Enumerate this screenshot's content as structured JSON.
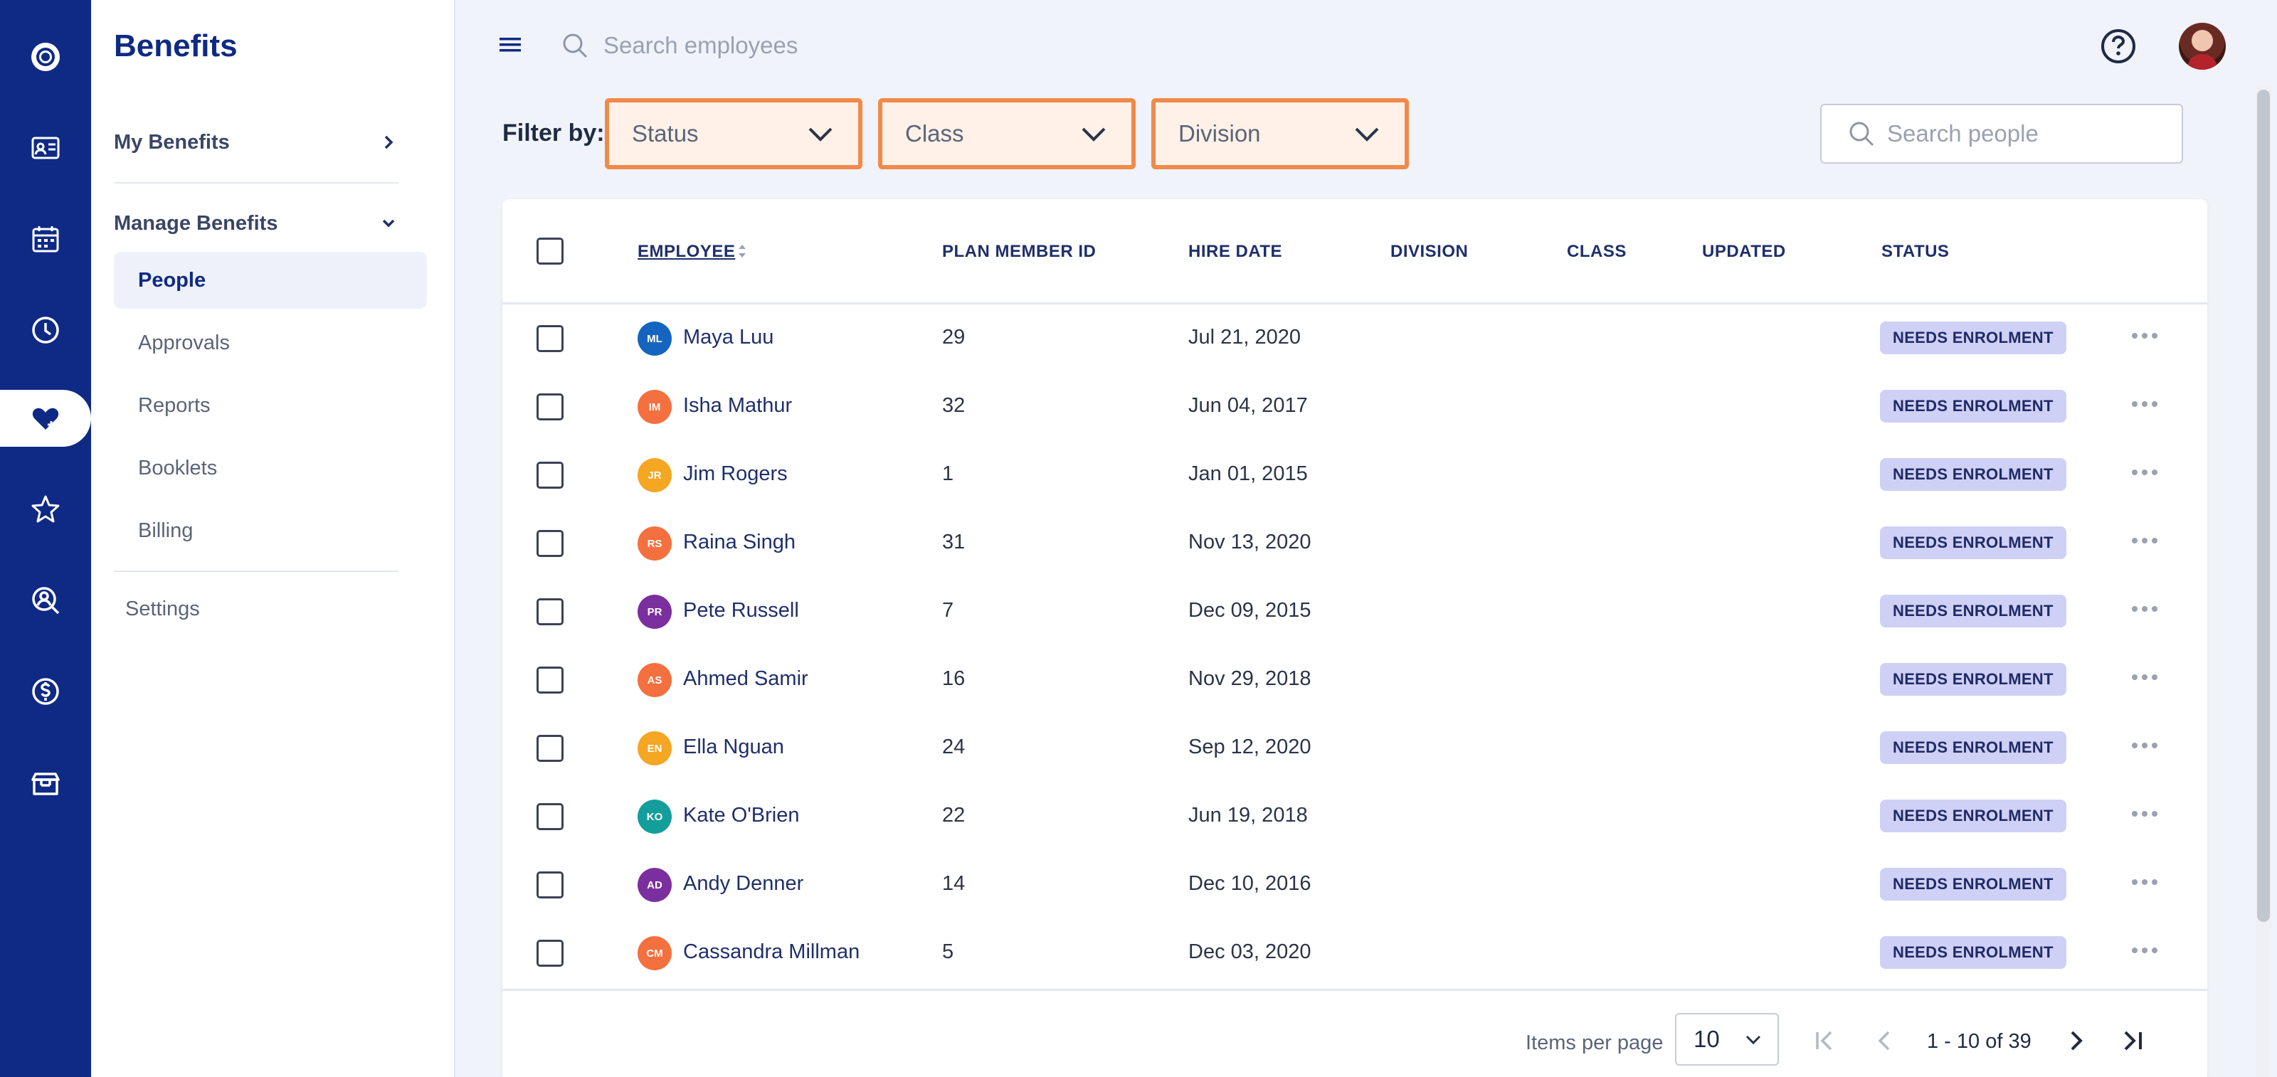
{
  "app": {
    "nav_rail": [
      {
        "icon": "logo-icon"
      },
      {
        "icon": "id-card-icon"
      },
      {
        "icon": "calendar-icon"
      },
      {
        "icon": "clock-icon"
      },
      {
        "icon": "heart-icon",
        "active": true
      },
      {
        "icon": "star-icon"
      },
      {
        "icon": "person-search-icon"
      },
      {
        "icon": "dollar-icon"
      },
      {
        "icon": "gift-box-icon"
      }
    ]
  },
  "sidebar": {
    "title": "Benefits",
    "my_benefits": "My Benefits",
    "manage_benefits": "Manage Benefits",
    "items": [
      {
        "label": "People",
        "active": true
      },
      {
        "label": "Approvals"
      },
      {
        "label": "Reports"
      },
      {
        "label": "Booklets"
      },
      {
        "label": "Billing"
      }
    ],
    "settings": "Settings"
  },
  "header": {
    "search_placeholder": "Search employees"
  },
  "filters": {
    "label": "Filter by:",
    "status": "Status",
    "class": "Class",
    "division": "Division",
    "search_placeholder": "Search people"
  },
  "table": {
    "columns": [
      "EMPLOYEE",
      "PLAN MEMBER ID",
      "HIRE DATE",
      "DIVISION",
      "CLASS",
      "UPDATED",
      "STATUS"
    ],
    "rows": [
      {
        "initials": "ML",
        "color": "#1565c0",
        "name": "Maya Luu",
        "id": "29",
        "hire": "Jul 21, 2020",
        "status": "NEEDS ENROLMENT"
      },
      {
        "initials": "IM",
        "color": "#f4703f",
        "name": "Isha Mathur",
        "id": "32",
        "hire": "Jun 04, 2017",
        "status": "NEEDS ENROLMENT"
      },
      {
        "initials": "JR",
        "color": "#f5a623",
        "name": "Jim Rogers",
        "id": "1",
        "hire": "Jan 01, 2015",
        "status": "NEEDS ENROLMENT"
      },
      {
        "initials": "RS",
        "color": "#f4703f",
        "name": "Raina Singh",
        "id": "31",
        "hire": "Nov 13, 2020",
        "status": "NEEDS ENROLMENT"
      },
      {
        "initials": "PR",
        "color": "#7b2f9e",
        "name": "Pete Russell",
        "id": "7",
        "hire": "Dec 09, 2015",
        "status": "NEEDS ENROLMENT"
      },
      {
        "initials": "AS",
        "color": "#f4703f",
        "name": "Ahmed Samir",
        "id": "16",
        "hire": "Nov 29, 2018",
        "status": "NEEDS ENROLMENT"
      },
      {
        "initials": "EN",
        "color": "#f5a623",
        "name": "Ella Nguan",
        "id": "24",
        "hire": "Sep 12, 2020",
        "status": "NEEDS ENROLMENT"
      },
      {
        "initials": "KO",
        "color": "#139e9b",
        "name": "Kate O'Brien",
        "id": "22",
        "hire": "Jun 19, 2018",
        "status": "NEEDS ENROLMENT"
      },
      {
        "initials": "AD",
        "color": "#7b2f9e",
        "name": "Andy Denner",
        "id": "14",
        "hire": "Dec 10, 2016",
        "status": "NEEDS ENROLMENT"
      },
      {
        "initials": "CM",
        "color": "#f4703f",
        "name": "Cassandra Millman",
        "id": "5",
        "hire": "Dec 03, 2020",
        "status": "NEEDS ENROLMENT"
      }
    ]
  },
  "pagination": {
    "items_per_page_label": "Items per page",
    "items_per_page": "10",
    "range": "1 - 10 of 39"
  },
  "colors": {
    "brand": "#0f2a85",
    "filter_highlight": "#f08a4b",
    "badge": "#cfd0f5"
  }
}
